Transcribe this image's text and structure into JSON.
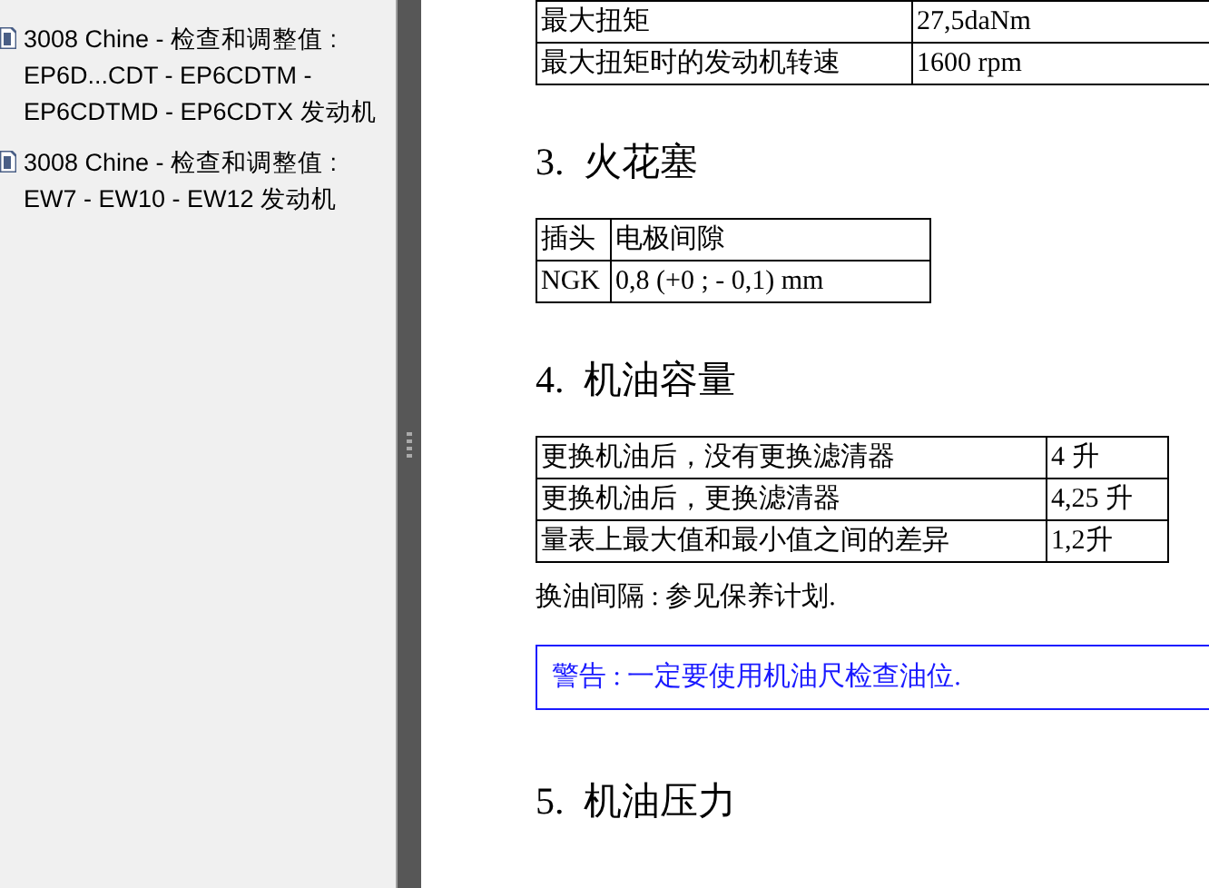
{
  "sidebar": {
    "items": [
      {
        "label": "3008 Chine - 检查和调整值 : EP6D...CDT - EP6CDTM - EP6CDTMD - EP6CDTX 发动机"
      },
      {
        "label": "3008 Chine - 检查和调整值 : EW7 - EW10 - EW12 发动机"
      }
    ]
  },
  "document": {
    "blocks": [
      {
        "kind": "table",
        "rows": [
          [
            "最大扭矩",
            "27,5daNm"
          ],
          [
            "最大扭矩时的发动机转速",
            "1600 rpm"
          ]
        ]
      },
      {
        "kind": "heading",
        "text": "3.  火花塞"
      },
      {
        "kind": "table",
        "rows": [
          [
            "插头",
            "电极间隙"
          ],
          [
            "NGK",
            "0,8 (+0 ; - 0,1) mm"
          ]
        ]
      },
      {
        "kind": "heading",
        "text": "4.  机油容量"
      },
      {
        "kind": "table",
        "rows": [
          [
            "更换机油后，没有更换滤清器",
            "4 升"
          ],
          [
            "更换机油后，更换滤清器",
            "4,25 升"
          ],
          [
            "量表上最大值和最小值之间的差异",
            "1,2升"
          ]
        ]
      },
      {
        "kind": "paragraph",
        "text": "换油间隔 : 参见保养计划."
      },
      {
        "kind": "warning",
        "text": "警告 : 一定要使用机油尺检查油位."
      },
      {
        "kind": "heading",
        "text": "5.  机油压力"
      }
    ]
  }
}
